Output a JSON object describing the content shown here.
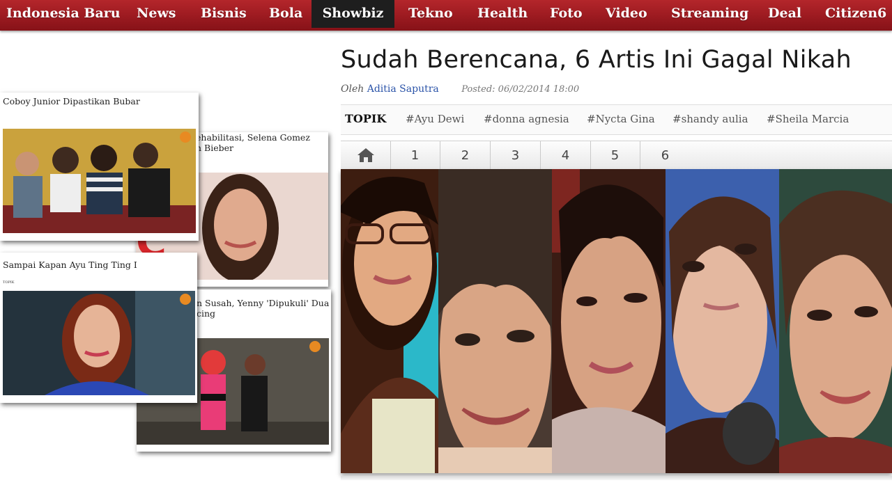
{
  "nav": {
    "items": [
      "Indonesia Baru",
      "News",
      "Bisnis",
      "Bola",
      "Showbiz",
      "Tekno",
      "Health",
      "Foto",
      "Video",
      "Streaming",
      "Deal",
      "Citizen6"
    ],
    "active": "Showbiz"
  },
  "article": {
    "title": "Sudah Berencana, 6 Artis Ini Gagal Nikah",
    "by_prefix": "Oleh",
    "author": "Aditia Saputra",
    "posted": "Posted: 06/02/2014 18:00",
    "topic_label": "TOPIK",
    "tags": [
      "#Ayu Dewi",
      "#donna agnesia",
      "#Nycta Gina",
      "#shandy aulia",
      "#Sheila Marcia"
    ]
  },
  "pager": {
    "home_icon": "home-icon",
    "pages": [
      "1",
      "2",
      "3",
      "4",
      "5",
      "6"
    ]
  },
  "collage": {
    "card1": {
      "title": "Coboy Junior Dipastikan Bubar"
    },
    "card2": {
      "title_line1": "ehabilitasi, Selena Gomez",
      "title_line2": "n Bieber"
    },
    "card3": {
      "title": "Sampai Kapan Ayu Ting Ting I",
      "topic": "TOPIK"
    },
    "card4": {
      "title_line1": "n Susah, Yenny 'Dipukuli' Dua",
      "title_line2": "cing"
    }
  },
  "colors": {
    "nav_red": "#9b1a20",
    "nav_active": "#1e1e1e",
    "author_link": "#2a53a8"
  }
}
